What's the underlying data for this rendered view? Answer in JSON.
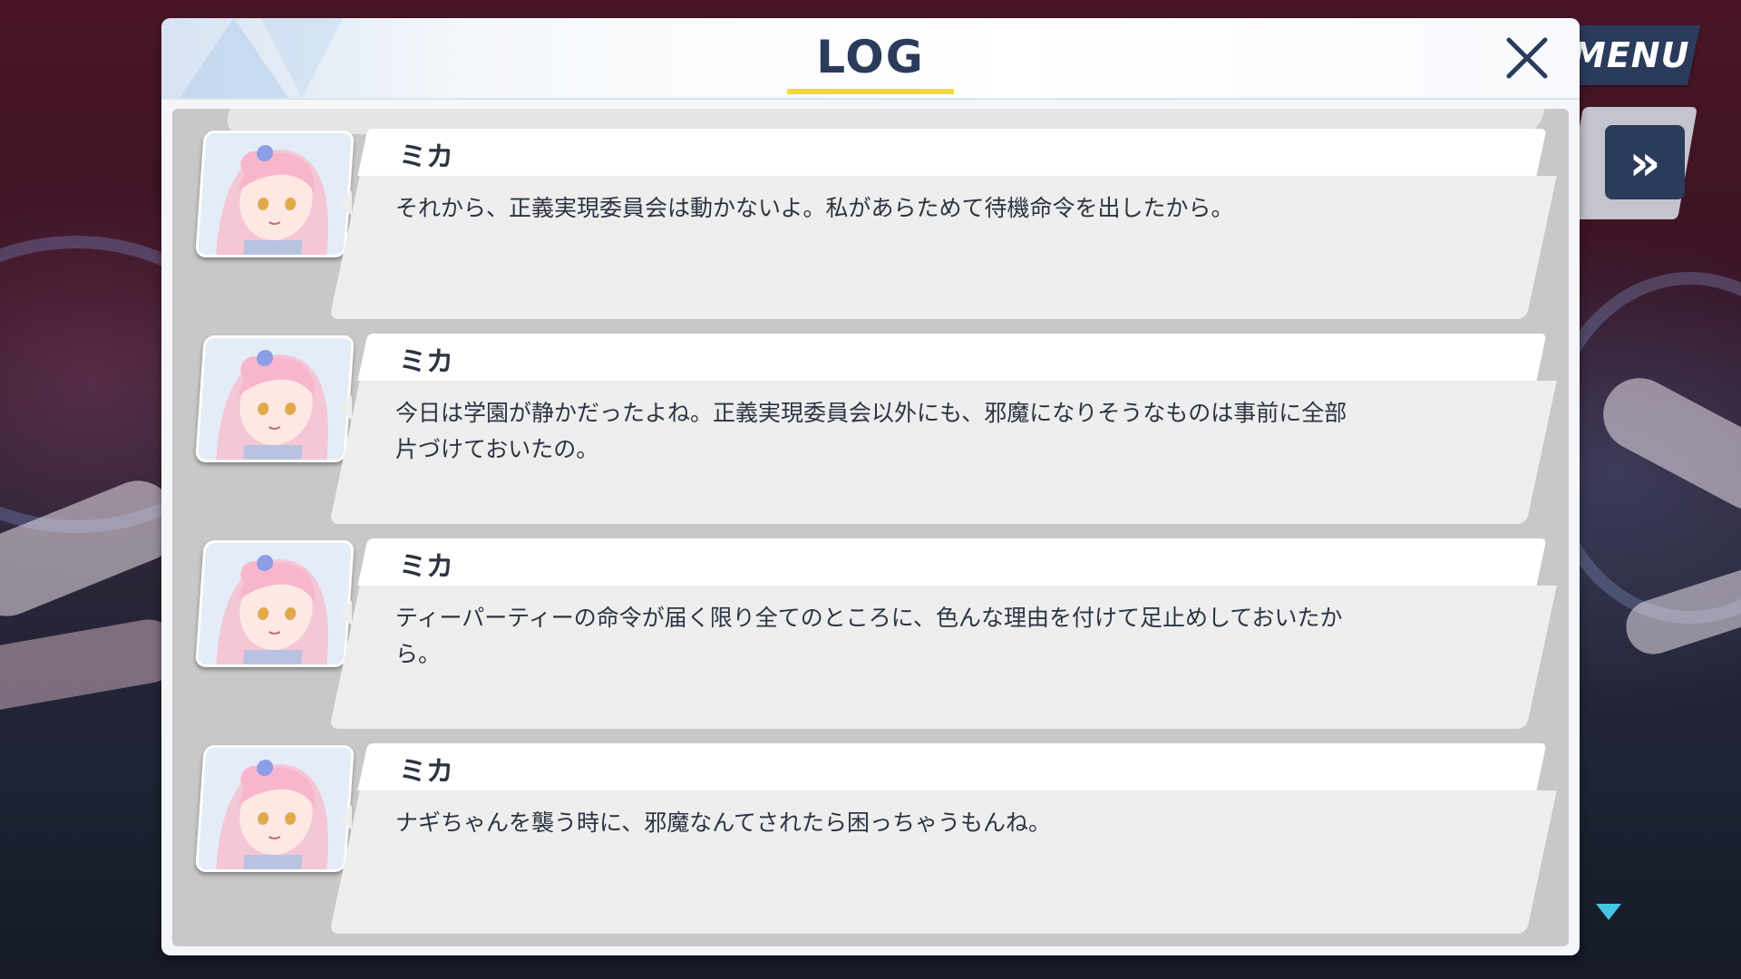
{
  "menu": {
    "label": "MENU",
    "skip_icon": "fast-forward-icon"
  },
  "log_panel": {
    "title": "LOG",
    "close_icon": "close-icon",
    "entries": [
      {
        "speaker": "ミカ",
        "text": "それから、正義実現委員会は動かないよ。私があらためて待機命令を出したから。"
      },
      {
        "speaker": "ミカ",
        "text": "今日は学園が静かだったよね。正義実現委員会以外にも、邪魔になりそうなものは事前に全部\n片づけておいたの。"
      },
      {
        "speaker": "ミカ",
        "text": "ティーパーティーの命令が届く限り全てのところに、色んな理由を付けて足止めしておいたか\nら。"
      },
      {
        "speaker": "ミカ",
        "text": "ナギちゃんを襲う時に、邪魔なんてされたら困っちゃうもんね。"
      }
    ]
  },
  "colors": {
    "accent_navy": "#2b3b5c",
    "underline_yellow": "#f2dc2a",
    "scroll_indicator": "#46c6e6"
  }
}
